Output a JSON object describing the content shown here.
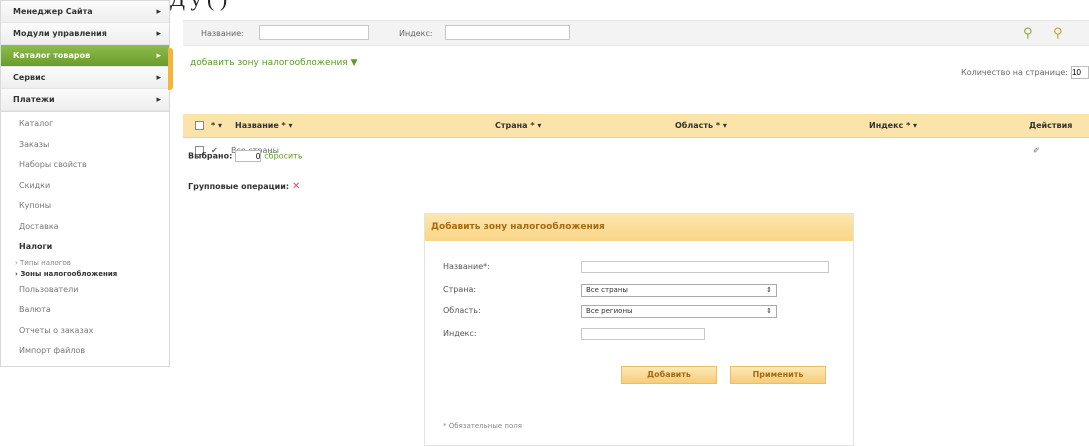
{
  "doc_fragment": "Д                                                 у                                                            (          )",
  "sidebar": {
    "top": [
      {
        "label": "Менеджер Сайта",
        "arrow": "▸",
        "active": false
      },
      {
        "label": "Модули управления",
        "arrow": "▸",
        "active": false
      },
      {
        "label": "Каталог товаров",
        "arrow": "▸",
        "active": true
      },
      {
        "label": "Сервис",
        "arrow": "▸",
        "active": false
      },
      {
        "label": "Платежи",
        "arrow": "▸",
        "active": false
      }
    ],
    "items": [
      "Каталог",
      "Заказы",
      "Наборы свойств",
      "Скидки",
      "Купоны",
      "Доставка"
    ],
    "taxes": "Налоги",
    "tax_sub": [
      "› Типы налогов",
      "› Зоны налогообложения"
    ],
    "items2": [
      "Пользователи",
      "Валюта",
      "Отчеты о заказах",
      "Импорт файлов"
    ]
  },
  "filter": {
    "name_label": "Название:",
    "index_label": "Индекс:"
  },
  "add_zone_link": "добавить зону налогообложения ▼",
  "per_page_label": "Количество на странице:",
  "per_page_value": "10",
  "table": {
    "headers": [
      "* ▾",
      "Название * ▾",
      "Страна * ▾",
      "Область * ▾",
      "Индекс * ▾",
      "Действия"
    ],
    "row": {
      "check": "✔",
      "name": "Все страны",
      "action": "✐"
    }
  },
  "selected_label": "Выбрано:",
  "selected_count": "0",
  "reset_label": "сбросить",
  "group_label": "Групповые операции:",
  "group_delete": "✕",
  "form": {
    "title": "Добавить зону налогообложения",
    "name_label": "Название*:",
    "country_label": "Страна:",
    "country_value": "Все страны",
    "region_label": "Область:",
    "region_value": "Все регионы",
    "index_label": "Индекс:",
    "add_button": "Добавить",
    "apply_button": "Применить",
    "required_note": "* Обязательные поля"
  },
  "icons": [
    "filter-apply-icon",
    "filter-clear-icon"
  ],
  "colors": {
    "accent_green": "#6a9c2c",
    "header_orange": "#fbe3aa",
    "link_green": "#5c9a2d"
  }
}
